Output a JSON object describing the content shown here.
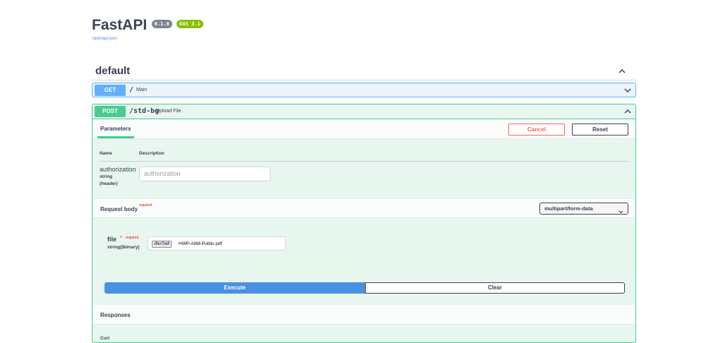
{
  "header": {
    "title": "FastAPI",
    "version_badge": "0.1.0",
    "oas_badge": "OAS 3.1",
    "spec_link": "/openapi.json"
  },
  "section": {
    "title": "default",
    "expanded": true
  },
  "operations": {
    "get": {
      "method": "GET",
      "path": "/",
      "summary": "Main",
      "expanded": false
    },
    "post": {
      "method": "POST",
      "path": "/std-bg",
      "summary": "Upload File",
      "expanded": true,
      "tab_label": "Parameters",
      "cancel_label": "Cancel",
      "reset_label": "Reset",
      "columns": {
        "name": "Name",
        "description": "Description"
      },
      "param": {
        "name": "authorization",
        "type": "string",
        "location": "(header)",
        "placeholder": "authorization"
      },
      "request_body": {
        "title": "Request body",
        "required_label": "required",
        "content_type": "multipart/form-data"
      },
      "file_field": {
        "name": "file",
        "star": "*",
        "required_label": "required",
        "type": "string($binary)",
        "choose_label": "เลือกไฟล์",
        "file_name": "HWP-AI68-Public.pdf"
      },
      "execute_label": "Execute",
      "clear_label": "Clear",
      "responses_title": "Responses",
      "curl_label": "Curl"
    }
  },
  "colors": {
    "get": "#61affe",
    "post": "#49cc90",
    "execute": "#4990e2",
    "cancel": "#ff6060"
  }
}
